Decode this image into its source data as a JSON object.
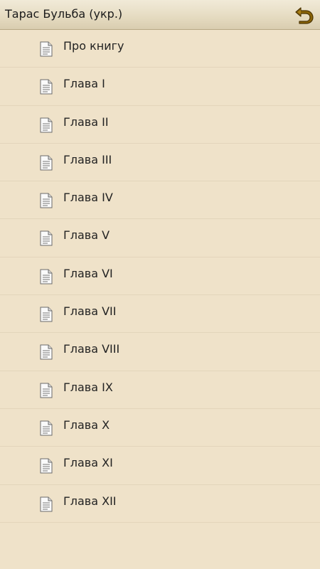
{
  "header": {
    "title": "Тарас Бульба (укр.)",
    "back_icon": "undo-arrow-icon"
  },
  "chapters": [
    {
      "label": "Про книгу"
    },
    {
      "label": "Глава I"
    },
    {
      "label": "Глава II"
    },
    {
      "label": "Глава III"
    },
    {
      "label": "Глава IV"
    },
    {
      "label": "Глава V"
    },
    {
      "label": "Глава VI"
    },
    {
      "label": "Глава VII"
    },
    {
      "label": "Глава VIII"
    },
    {
      "label": "Глава IX"
    },
    {
      "label": "Глава X"
    },
    {
      "label": "Глава XI"
    },
    {
      "label": "Глава XII"
    }
  ],
  "row_icon": "document-icon",
  "colors": {
    "background": "#efe2c9",
    "accent": "#7a5a08"
  }
}
